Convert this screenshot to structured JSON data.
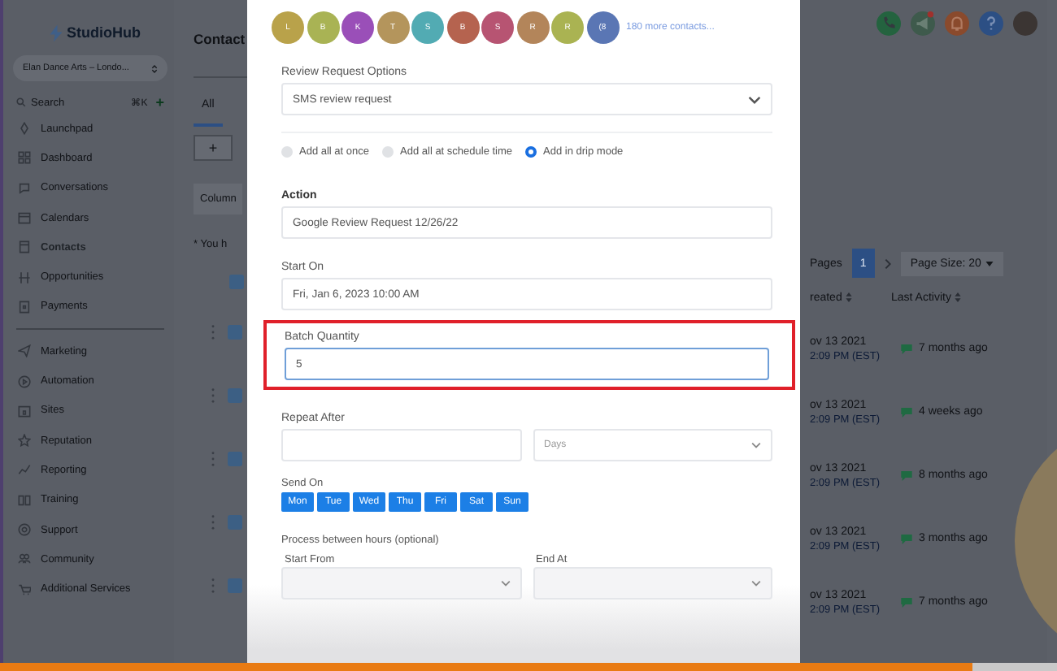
{
  "sidebar": {
    "logo": "StudioHub",
    "account": "Elan Dance Arts – Londo...",
    "search": {
      "placeholder": "Search",
      "shortcut": "⌘K",
      "add": "+"
    },
    "sections": [
      {
        "items": [
          {
            "label": "Launchpad",
            "selected": false
          },
          {
            "label": "Dashboard",
            "selected": false
          },
          {
            "label": "Conversations",
            "selected": false
          },
          {
            "label": "Calendars",
            "selected": false
          },
          {
            "label": "Contacts",
            "selected": true
          },
          {
            "label": "Opportunities",
            "selected": false
          },
          {
            "label": "Payments",
            "selected": false
          }
        ]
      },
      {
        "items": [
          {
            "label": "Marketing",
            "selected": false
          },
          {
            "label": "Automation",
            "selected": false
          },
          {
            "label": "Sites",
            "selected": false
          },
          {
            "label": "Reputation",
            "selected": false
          },
          {
            "label": "Reporting",
            "selected": false
          },
          {
            "label": "Training",
            "selected": false
          },
          {
            "label": "Support",
            "selected": false
          },
          {
            "label": "Community",
            "selected": false
          },
          {
            "label": "Additional Services",
            "selected": false
          }
        ]
      }
    ]
  },
  "contacts": {
    "title": "Contact",
    "tab": {
      "label": "All",
      "selected": true
    },
    "add_button": "+",
    "columns_button": "Column",
    "notice": "* You h",
    "pagination": {
      "label": "Pages",
      "page": "1",
      "page_size": "Page Size: 20"
    },
    "table": {
      "header_checked": true,
      "columns": [
        "reated",
        "Last Activity"
      ],
      "rows": [
        {
          "checked": true,
          "created_date": "ov 13 2021",
          "created_time": "2:09 PM (EST)",
          "last_activity": "7 months ago"
        },
        {
          "checked": true,
          "created_date": "ov 13 2021",
          "created_time": "2:09 PM (EST)",
          "last_activity": "4 weeks ago"
        },
        {
          "checked": true,
          "created_date": "ov 13 2021",
          "created_time": "2:09 PM (EST)",
          "last_activity": "8 months ago"
        },
        {
          "checked": true,
          "created_date": "ov 13 2021",
          "created_time": "2:09 PM (EST)",
          "last_activity": "3 months ago"
        },
        {
          "checked": true,
          "created_date": "ov 13 2021",
          "created_time": "2:09 PM (EST)",
          "last_activity": "7 months ago"
        }
      ]
    }
  },
  "modal": {
    "recipients": [
      {
        "initial": "L",
        "color": "#b9a24a"
      },
      {
        "initial": "B",
        "color": "#a9b354"
      },
      {
        "initial": "K",
        "color": "#9a4fb8"
      },
      {
        "initial": "T",
        "color": "#b4955c"
      },
      {
        "initial": "S",
        "color": "#52abb3"
      },
      {
        "initial": "B",
        "color": "#b5634f"
      },
      {
        "initial": "S",
        "color": "#b75472"
      },
      {
        "initial": "R",
        "color": "#b3855a"
      },
      {
        "initial": "R",
        "color": "#aab352"
      },
      {
        "initial": "(8",
        "color": "#5a76b4"
      }
    ],
    "more_link": "180 more contacts...",
    "review_options": {
      "label": "Review Request Options",
      "value": "SMS review request"
    },
    "add_modes": [
      {
        "label": "Add all at once",
        "selected": false
      },
      {
        "label": "Add all at schedule time",
        "selected": false
      },
      {
        "label": "Add in drip mode",
        "selected": true
      }
    ],
    "action": {
      "label": "Action",
      "value": "Google Review Request 12/26/22"
    },
    "start_on": {
      "label": "Start On",
      "value": "Fri, Jan 6, 2023 10:00 AM"
    },
    "batch_quantity": {
      "label": "Batch Quantity",
      "value": "5",
      "highlighted": true
    },
    "repeat_after": {
      "label": "Repeat After",
      "unit": "Days"
    },
    "send_on": {
      "label": "Send On",
      "days": [
        {
          "label": "Mon",
          "selected": true
        },
        {
          "label": "Tue",
          "selected": true
        },
        {
          "label": "Wed",
          "selected": true
        },
        {
          "label": "Thu",
          "selected": true
        },
        {
          "label": "Fri",
          "selected": true
        },
        {
          "label": "Sat",
          "selected": true
        },
        {
          "label": "Sun",
          "selected": true
        }
      ]
    },
    "hours": {
      "label": "Process between hours (optional)",
      "start_label": "Start From",
      "end_label": "End At"
    }
  },
  "video_progress": {
    "level": 0.92
  }
}
